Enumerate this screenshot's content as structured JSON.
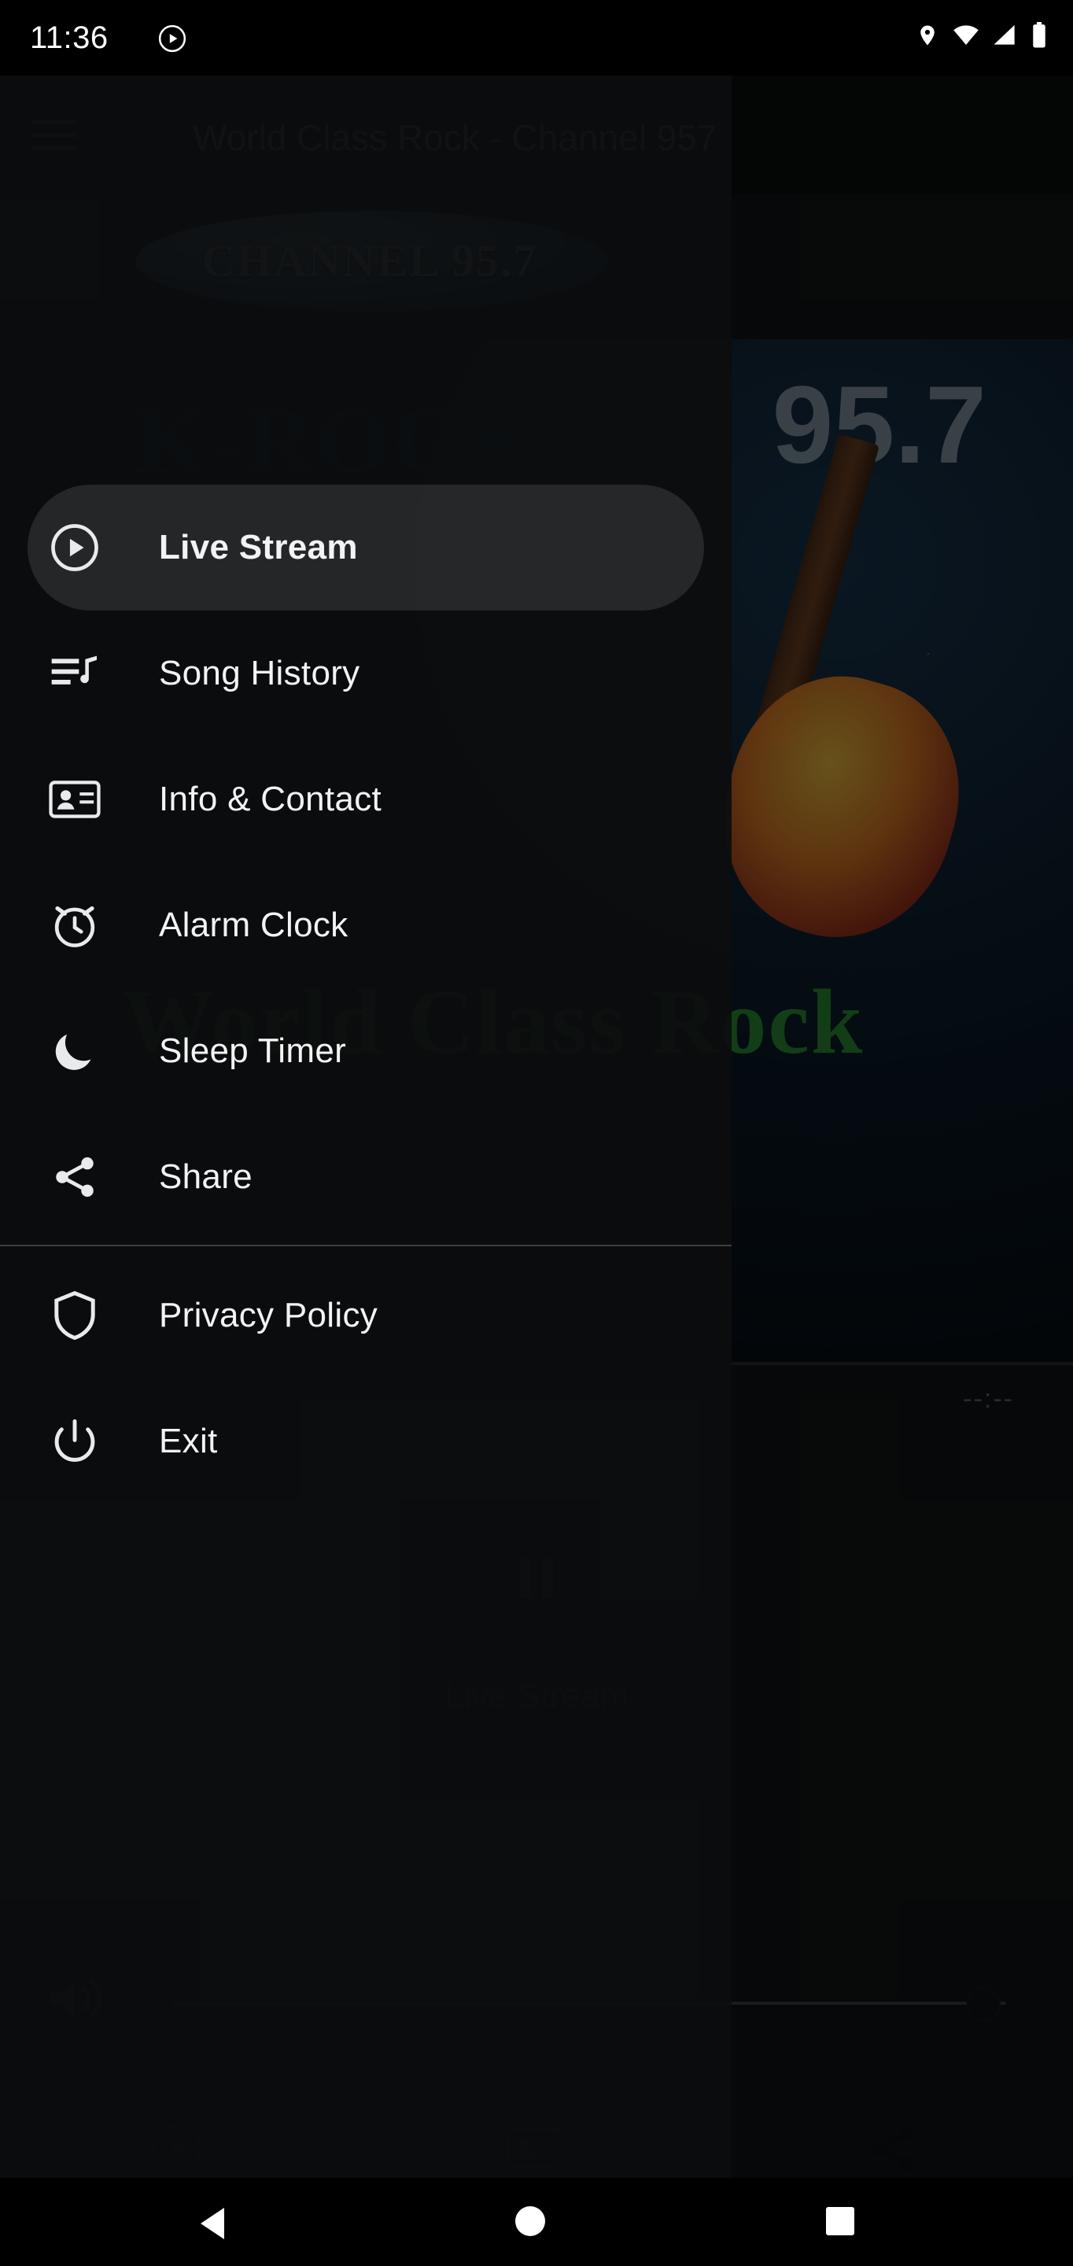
{
  "status_bar": {
    "time": "11:36",
    "left_icons": [
      "play-circle-icon"
    ],
    "right_icons": [
      "location-icon",
      "wifi-icon",
      "cell-signal-icon",
      "battery-icon"
    ]
  },
  "app": {
    "title": "World Class Rock - Channel 957",
    "menu_icon": "hamburger-menu-icon",
    "banner_text": "CHANNEL 95.7",
    "artwork": {
      "station_mark": "K-ROCK",
      "frequency": "95.7",
      "tagline": "World Class Rock"
    },
    "player": {
      "elapsed_time": "--:--",
      "transport_icon": "pause-icon",
      "now_playing": "Live Stream",
      "volume_icon": "volume-icon",
      "volume_percent": 100
    },
    "bottom_bar": [
      {
        "name": "play-icon"
      },
      {
        "name": "contact-card-icon"
      },
      {
        "name": "share-icon"
      }
    ]
  },
  "drawer": {
    "items": [
      {
        "label": "Live Stream",
        "icon": "play-circle-icon",
        "selected": true
      },
      {
        "label": "Song History",
        "icon": "playlist-icon",
        "selected": false
      },
      {
        "label": "Info & Contact",
        "icon": "contact-card-icon",
        "selected": false
      },
      {
        "label": "Alarm Clock",
        "icon": "alarm-clock-icon",
        "selected": false
      },
      {
        "label": "Sleep Timer",
        "icon": "moon-icon",
        "selected": false
      },
      {
        "label": "Share",
        "icon": "share-icon",
        "selected": false
      },
      {
        "label": "Privacy Policy",
        "icon": "shield-icon",
        "selected": false
      },
      {
        "label": "Exit",
        "icon": "power-icon",
        "selected": false
      }
    ]
  },
  "system_nav": {
    "back": "back-triangle-icon",
    "home": "home-circle-icon",
    "recents": "recents-square-icon"
  },
  "colors": {
    "accent_green": "#2e9c36",
    "banner_blue": "#49a7d4",
    "drawer_bg": "#0c0d0e",
    "selected_pill": "rgba(255,255,255,0.11)"
  }
}
